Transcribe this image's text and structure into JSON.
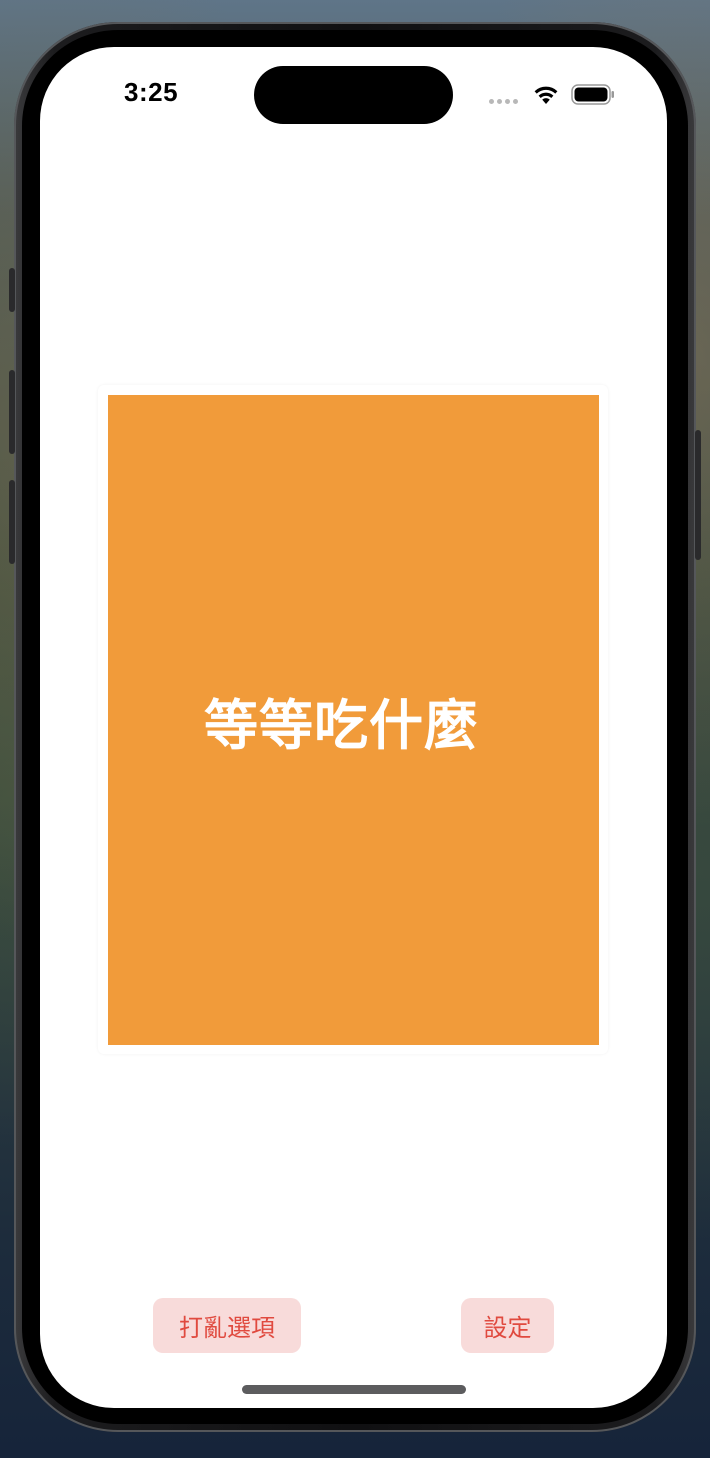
{
  "status_bar": {
    "time": "3:25",
    "icons": [
      "cellular-signal-icon",
      "wifi-icon",
      "battery-icon"
    ]
  },
  "main": {
    "card_title": "等等吃什麼",
    "card_color": "#f19b3a"
  },
  "toolbar": {
    "shuffle_label": "打亂選項",
    "settings_label": "設定",
    "button_bg": "#f8dbda",
    "button_text_color": "#e04a3f"
  }
}
